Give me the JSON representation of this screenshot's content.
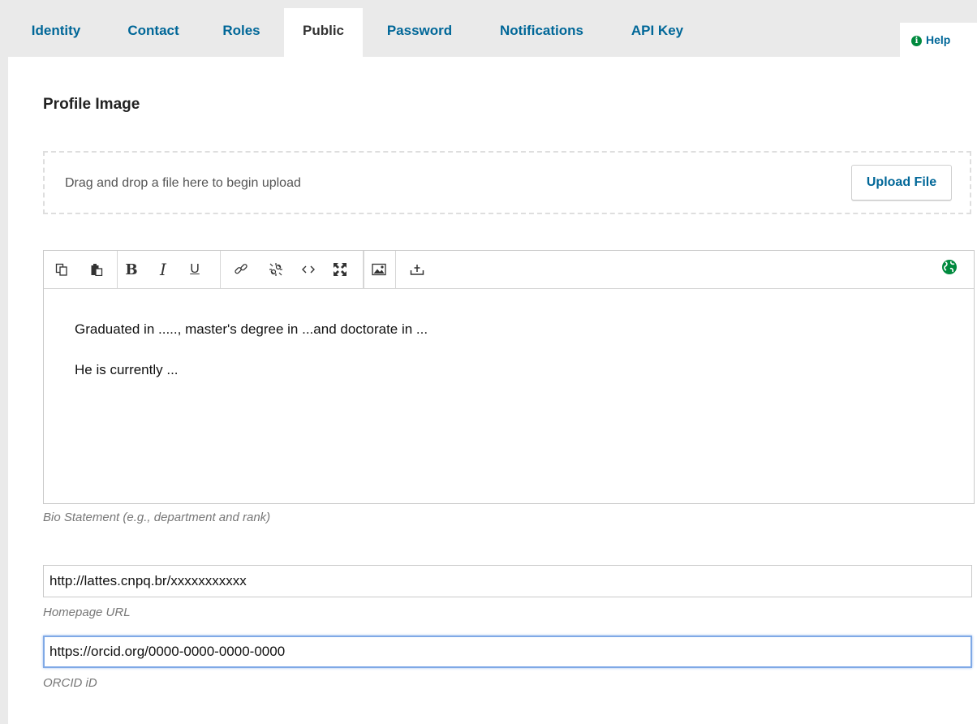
{
  "tabs": [
    {
      "label": "Identity",
      "active": false
    },
    {
      "label": "Contact",
      "active": false
    },
    {
      "label": "Roles",
      "active": false
    },
    {
      "label": "Public",
      "active": true
    },
    {
      "label": "Password",
      "active": false
    },
    {
      "label": "Notifications",
      "active": false
    },
    {
      "label": "API Key",
      "active": false
    }
  ],
  "help": {
    "label": "Help",
    "icon": "info-icon"
  },
  "profile_image": {
    "title": "Profile Image",
    "dropzone_text": "Drag and drop a file here to begin upload",
    "upload_button": "Upload File"
  },
  "editor": {
    "toolbar_icons": [
      "copy-icon",
      "paste-icon",
      "bold-icon",
      "italic-icon",
      "underline-icon",
      "link-icon",
      "unlink-icon",
      "code-icon",
      "fullscreen-icon",
      "image-icon",
      "upload-icon",
      "language-globe-icon"
    ],
    "bold_glyph": "B",
    "italic_glyph": "I",
    "underline_glyph": "U",
    "paragraphs": [
      "Graduated in ....., master's degree in ...and doctorate in ...",
      "He is currently ..."
    ],
    "label": "Bio Statement (e.g., department and rank)"
  },
  "homepage": {
    "value": "http://lattes.cnpq.br/xxxxxxxxxxx",
    "label": "Homepage URL"
  },
  "orcid": {
    "value": "https://orcid.org/0000-0000-0000-0000",
    "label": "ORCID iD"
  },
  "colors": {
    "link_blue": "#006798",
    "green": "#008a3e",
    "focus_blue": "#7fa9e6"
  }
}
